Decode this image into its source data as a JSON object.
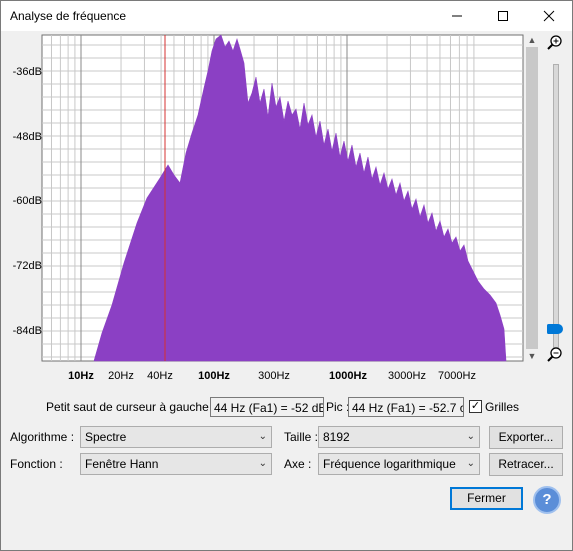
{
  "window": {
    "title": "Analyse de fréquence"
  },
  "plot": {
    "y_ticks": [
      "-36dB",
      "-48dB",
      "-60dB",
      "-72dB",
      "-84dB"
    ],
    "x_ticks": [
      "10Hz",
      "20Hz",
      "40Hz",
      "100Hz",
      "300Hz",
      "1000Hz",
      "3000Hz",
      "7000Hz"
    ],
    "fill_color": "#8b40c4",
    "cursor_color": "#d43030"
  },
  "cursor": {
    "label": "Petit saut de curseur à gauche :",
    "value": "44 Hz (Fa1) = -52 dB",
    "peak_label": "Pic :",
    "peak_value": "44 Hz (Fa1) = -52.7 c",
    "grids_label": "Grilles"
  },
  "controls": {
    "algorithm_label": "Algorithme :",
    "algorithm_value": "Spectre",
    "size_label": "Taille :",
    "size_value": "8192",
    "export_label": "Exporter...",
    "function_label": "Fonction :",
    "function_value": "Fenêtre Hann",
    "axis_label": "Axe :",
    "axis_value": "Fréquence logarithmique",
    "replot_label": "Retracer...",
    "close_label": "Fermer",
    "help_label": "?"
  }
}
